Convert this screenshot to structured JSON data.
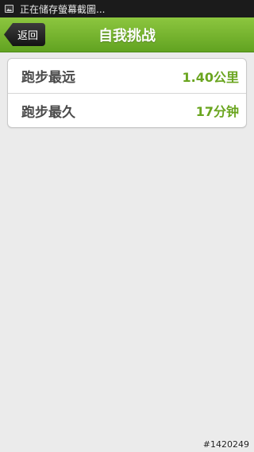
{
  "status_bar": {
    "text": "正在储存螢幕截圖...",
    "icon": "screenshot-icon"
  },
  "header": {
    "back_label": "返回",
    "title": "自我挑战",
    "color": "#7ab82f"
  },
  "records": [
    {
      "label": "跑步最远",
      "value": "1.40公里"
    },
    {
      "label": "跑步最久",
      "value": "17分钟"
    }
  ],
  "accent_color": "#6aa51f",
  "watermark": "#1420249"
}
